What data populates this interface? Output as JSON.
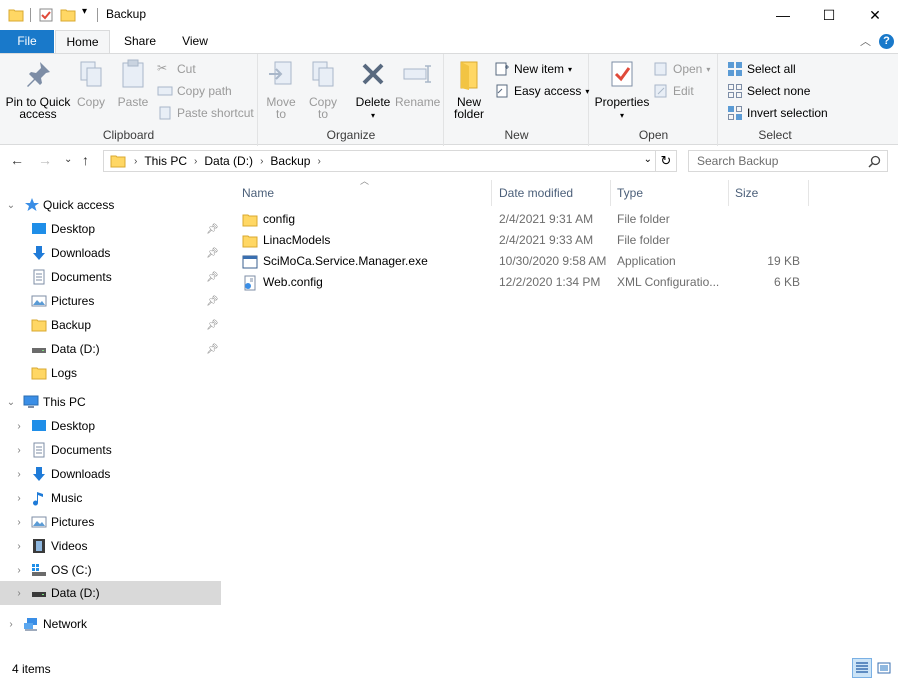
{
  "window": {
    "title": "Backup",
    "minimize_glyph": "—",
    "maximize_glyph": "☐",
    "close_glyph": "✕"
  },
  "quick_access_toolbar": {
    "icons": [
      "folder-icon",
      "properties-check-icon",
      "new-folder-icon",
      "customize-dropdown-icon"
    ]
  },
  "ribbon_tabs": [
    {
      "label": "File"
    },
    {
      "label": "Home"
    },
    {
      "label": "Share"
    },
    {
      "label": "View"
    }
  ],
  "ribbon": {
    "clipboard": {
      "group_label": "Clipboard",
      "pin_label": "Pin to Quick\naccess",
      "copy_label": "Copy",
      "paste_label": "Paste",
      "cut_label": "Cut",
      "copy_path_label": "Copy path",
      "paste_shortcut_label": "Paste shortcut"
    },
    "organize": {
      "group_label": "Organize",
      "move_to_label": "Move\nto",
      "copy_to_label": "Copy\nto",
      "delete_label": "Delete",
      "rename_label": "Rename"
    },
    "new": {
      "group_label": "New",
      "new_folder_label": "New\nfolder",
      "new_item_label": "New item",
      "easy_access_label": "Easy access"
    },
    "open": {
      "group_label": "Open",
      "properties_label": "Properties",
      "open_label": "Open",
      "edit_label": "Edit"
    },
    "select": {
      "group_label": "Select",
      "select_all_label": "Select all",
      "select_none_label": "Select none",
      "invert_selection_label": "Invert selection"
    }
  },
  "address_bar": {
    "breadcrumbs": [
      "This PC",
      "Data (D:)",
      "Backup"
    ],
    "search_placeholder": "Search Backup"
  },
  "nav_pane": {
    "quick_access": {
      "label": "Quick access",
      "items": [
        {
          "label": "Desktop",
          "icon": "desktop-icon",
          "pinned": true
        },
        {
          "label": "Downloads",
          "icon": "downloads-icon",
          "pinned": true
        },
        {
          "label": "Documents",
          "icon": "documents-icon",
          "pinned": true
        },
        {
          "label": "Pictures",
          "icon": "pictures-icon",
          "pinned": true
        },
        {
          "label": "Backup",
          "icon": "folder-icon",
          "pinned": true
        },
        {
          "label": "Data (D:)",
          "icon": "drive-icon",
          "pinned": true
        },
        {
          "label": "Logs",
          "icon": "folder-icon",
          "pinned": false
        }
      ]
    },
    "this_pc": {
      "label": "This PC",
      "items": [
        {
          "label": "Desktop",
          "icon": "desktop-icon"
        },
        {
          "label": "Documents",
          "icon": "documents-icon"
        },
        {
          "label": "Downloads",
          "icon": "downloads-icon"
        },
        {
          "label": "Music",
          "icon": "music-icon"
        },
        {
          "label": "Pictures",
          "icon": "pictures-icon"
        },
        {
          "label": "Videos",
          "icon": "videos-icon"
        },
        {
          "label": "OS (C:)",
          "icon": "os-drive-icon"
        },
        {
          "label": "Data (D:)",
          "icon": "drive-icon",
          "selected": true
        }
      ]
    },
    "network": {
      "label": "Network"
    }
  },
  "file_list": {
    "columns": [
      "Name",
      "Date modified",
      "Type",
      "Size"
    ],
    "rows": [
      {
        "name": "config",
        "date_modified": "2/4/2021 9:31 AM",
        "type": "File folder",
        "size": "",
        "icon": "folder-icon"
      },
      {
        "name": "LinacModels",
        "date_modified": "2/4/2021 9:33 AM",
        "type": "File folder",
        "size": "",
        "icon": "folder-icon"
      },
      {
        "name": "SciMoCa.Service.Manager.exe",
        "date_modified": "10/30/2020 9:58 AM",
        "type": "Application",
        "size": "19 KB",
        "icon": "application-icon"
      },
      {
        "name": "Web.config",
        "date_modified": "12/2/2020 1:34 PM",
        "type": "XML Configuratio...",
        "size": "6 KB",
        "icon": "config-file-icon"
      }
    ]
  },
  "status_bar": {
    "item_count": "4 items"
  },
  "colors": {
    "file_tab": "#1979ca",
    "folder": "#ffd764",
    "selection": "#d9d9d9",
    "header_text": "#4c607a"
  }
}
